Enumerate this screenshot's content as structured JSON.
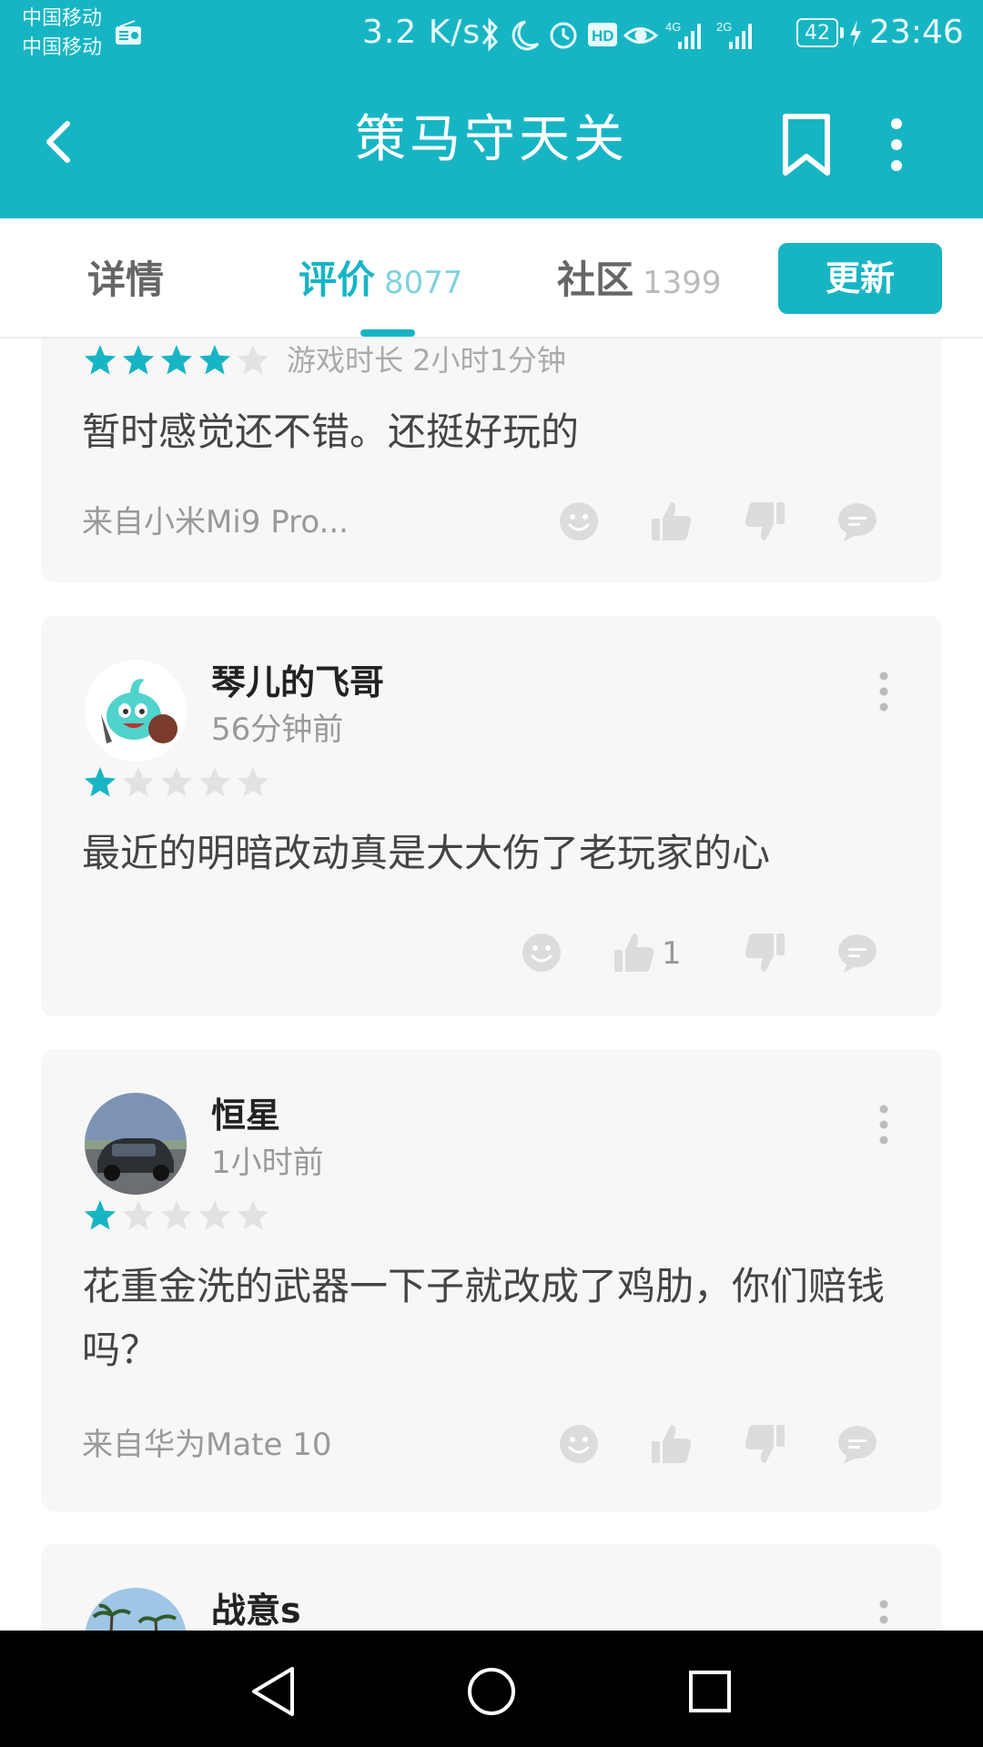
{
  "status_bar": {
    "carrier_1": "中国移动",
    "carrier_2": "中国移动",
    "net_speed": "3.2 K/s",
    "battery": "42",
    "time": "23:46",
    "icons": [
      "radio-icon",
      "bluetooth-icon",
      "moon-icon",
      "alarm-icon",
      "hd-icon",
      "eye-icon",
      "signal-4g-icon",
      "signal-2g-icon",
      "battery-icon",
      "charging-icon"
    ]
  },
  "header": {
    "title": "策马守天关",
    "back_icon": "chevron-left-icon",
    "bookmark_icon": "bookmark-icon",
    "more_icon": "more-vertical-icon"
  },
  "tabs": [
    {
      "label": "详情",
      "count": ""
    },
    {
      "label": "评价",
      "count": "8077",
      "active": true
    },
    {
      "label": "社区",
      "count": "1399"
    }
  ],
  "update_button": "更新",
  "colors": {
    "accent": "#17b5c4",
    "star_empty": "#e2e2e2",
    "card_bg": "#f7f7f7",
    "muted_text": "#999999"
  },
  "reviews": [
    {
      "user": "",
      "time": "",
      "rating": 4,
      "playtime": "游戏时长 2小时1分钟",
      "content": "暂时感觉还不错。还挺好玩的",
      "device": "来自小米Mi9 Pro...",
      "likes": ""
    },
    {
      "user": "琴儿的飞哥",
      "time": "56分钟前",
      "rating": 1,
      "playtime": "",
      "content": "最近的明暗改动真是大大伤了老玩家的心",
      "device": "",
      "likes": "1"
    },
    {
      "user": "恒星",
      "time": "1小时前",
      "rating": 1,
      "playtime": "",
      "content": "花重金洗的武器一下子就改成了鸡肋，你们赔钱吗？",
      "device": "来自华为Mate 10",
      "likes": ""
    },
    {
      "user": "战意s",
      "time": "",
      "rating": null,
      "playtime": "",
      "content": "",
      "device": "",
      "likes": ""
    }
  ],
  "action_icons": [
    "emoji-icon",
    "thumbs-up-icon",
    "thumbs-down-icon",
    "comment-icon"
  ],
  "nav_bar": [
    "back-triangle-icon",
    "home-circle-icon",
    "recents-square-icon"
  ]
}
